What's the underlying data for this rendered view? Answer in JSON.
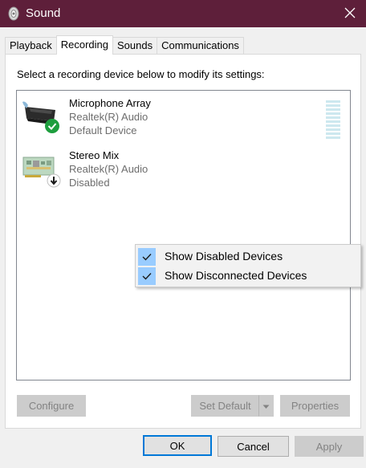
{
  "window": {
    "title": "Sound",
    "titlebar_color": "#5e1f3a",
    "icon": "speaker-icon"
  },
  "tabs": [
    {
      "label": "Playback",
      "active": false
    },
    {
      "label": "Recording",
      "active": true
    },
    {
      "label": "Sounds",
      "active": false
    },
    {
      "label": "Communications",
      "active": false
    }
  ],
  "recording": {
    "instruction": "Select a recording device below to modify its settings:",
    "devices": [
      {
        "name": "Microphone Array",
        "driver": "Realtek(R) Audio",
        "status": "Default Device",
        "icon": "microphone-array-icon",
        "badge": "green-check-icon",
        "level_meter": true
      },
      {
        "name": "Stereo Mix",
        "driver": "Realtek(R) Audio",
        "status": "Disabled",
        "icon": "sound-card-icon",
        "badge": "disabled-arrow-icon",
        "level_meter": false
      }
    ],
    "context_menu": [
      {
        "label": "Show Disabled Devices",
        "checked": true
      },
      {
        "label": "Show Disconnected Devices",
        "checked": true
      }
    ],
    "buttons": {
      "configure": "Configure",
      "set_default": "Set Default",
      "properties": "Properties"
    }
  },
  "dialog_buttons": {
    "ok": "OK",
    "cancel": "Cancel",
    "apply": "Apply"
  },
  "colors": {
    "accent": "#0078d7",
    "menu_highlight": "#99ccff",
    "default_badge": "#1e9e3e"
  }
}
